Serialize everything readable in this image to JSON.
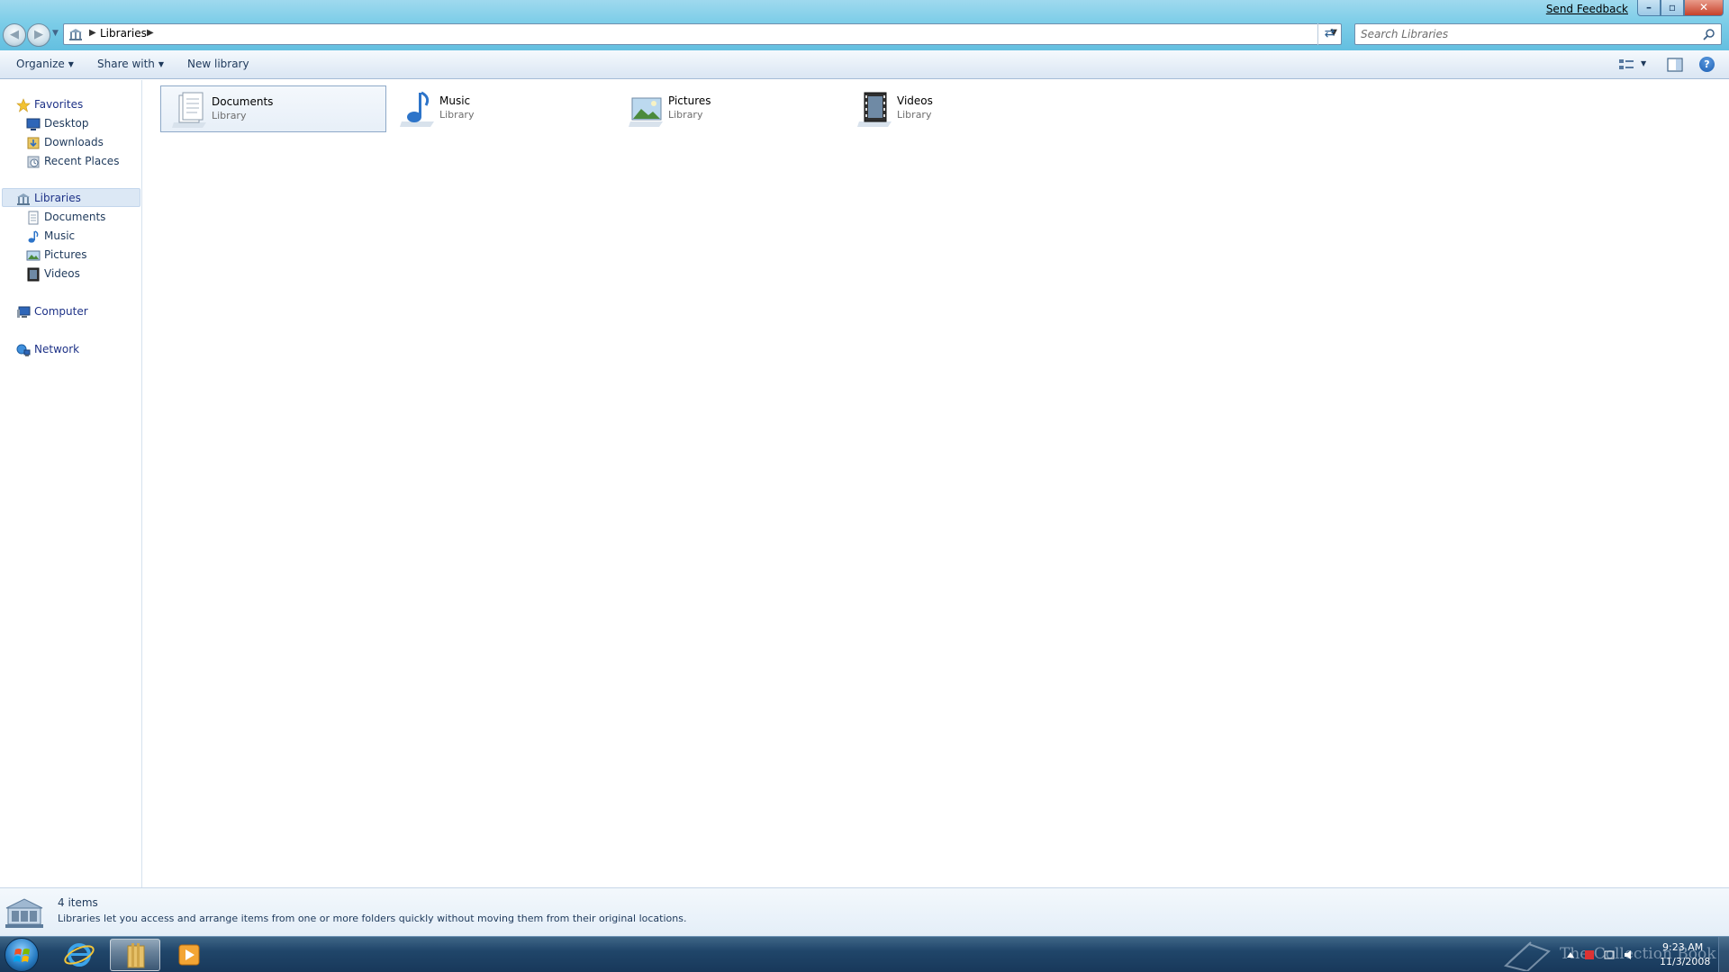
{
  "window": {
    "feedback_link": "Send Feedback"
  },
  "address": {
    "crumb": "Libraries",
    "search_placeholder": "Search Libraries"
  },
  "commandbar": {
    "organize": "Organize",
    "share_with": "Share with",
    "new_library": "New library"
  },
  "navpane": {
    "favorites": {
      "label": "Favorites",
      "items": [
        {
          "label": "Desktop",
          "icon": "desktop-icon"
        },
        {
          "label": "Downloads",
          "icon": "downloads-icon"
        },
        {
          "label": "Recent Places",
          "icon": "recent-places-icon"
        }
      ]
    },
    "libraries": {
      "label": "Libraries",
      "items": [
        {
          "label": "Documents",
          "icon": "documents-icon"
        },
        {
          "label": "Music",
          "icon": "music-icon"
        },
        {
          "label": "Pictures",
          "icon": "pictures-icon"
        },
        {
          "label": "Videos",
          "icon": "videos-icon"
        }
      ]
    },
    "computer": {
      "label": "Computer",
      "icon": "computer-icon"
    },
    "network": {
      "label": "Network",
      "icon": "network-icon"
    }
  },
  "content": {
    "libraries": [
      {
        "name": "Documents",
        "type": "Library",
        "icon": "documents-library-icon",
        "selected": true
      },
      {
        "name": "Music",
        "type": "Library",
        "icon": "music-library-icon",
        "selected": false
      },
      {
        "name": "Pictures",
        "type": "Library",
        "icon": "pictures-library-icon",
        "selected": false
      },
      {
        "name": "Videos",
        "type": "Library",
        "icon": "videos-library-icon",
        "selected": false
      }
    ]
  },
  "details": {
    "count": "4 items",
    "description": "Libraries let you access and arrange items from one or more folders quickly without moving them from their original locations."
  },
  "taskbar": {
    "watermark": "The Collection Book",
    "time": "9:23 AM",
    "date": "11/3/2008"
  },
  "colors": {
    "accent": "#1e3287",
    "selection": "#dce8f5",
    "taskbar": "#20466a"
  }
}
